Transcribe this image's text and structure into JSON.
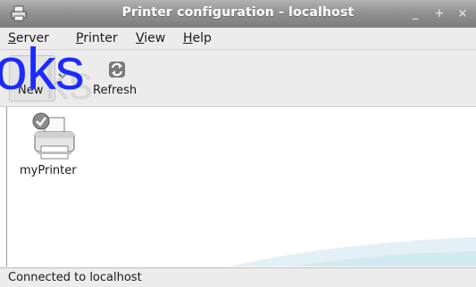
{
  "window": {
    "title": "Printer configuration - localhost",
    "controls": [
      "_",
      "+",
      "×"
    ]
  },
  "menubar": {
    "items": [
      {
        "label": "Server",
        "underline": "S"
      },
      {
        "label": "Printer",
        "underline": "P"
      },
      {
        "label": "View",
        "underline": "V"
      },
      {
        "label": "Help",
        "underline": "H"
      }
    ]
  },
  "toolbar": {
    "new_label": "New",
    "refresh_label": "Refresh"
  },
  "overlay": {
    "text": "oks"
  },
  "printers": [
    {
      "name": "myPrinter",
      "is_default": true
    }
  ],
  "status": {
    "text": "Connected to localhost"
  },
  "colors": {
    "overlay_text": "#1b2bff",
    "titlebar": "#8f8f8f",
    "background": "#ececec"
  }
}
